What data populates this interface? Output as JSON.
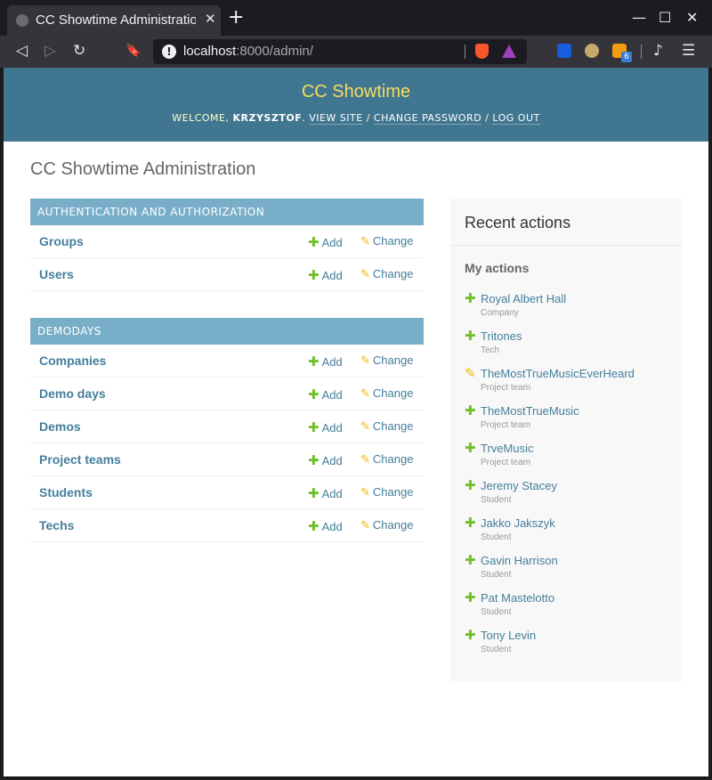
{
  "browser": {
    "tab_title": "CC Showtime Administration",
    "close_symbol": "✕",
    "newtab_symbol": "+",
    "url_host": "localhost",
    "url_rest": ":8000/admin/",
    "extension_badge": "6",
    "window_controls": {
      "minimize": "—",
      "maximize": "☐",
      "close": "✕"
    },
    "nav_glyphs": {
      "back": "◁",
      "forward": "▷",
      "reload": "↻",
      "bookmark": "🔖",
      "menu": "☰",
      "playlist": "♪"
    }
  },
  "header": {
    "site_name": "CC Showtime",
    "welcome": "WELCOME,",
    "username": "KRZYSZTOF",
    "links": [
      "VIEW SITE",
      "CHANGE PASSWORD",
      "LOG OUT"
    ],
    "sep": "/"
  },
  "page_title": "CC Showtime Administration",
  "labels": {
    "add": "Add",
    "change": "Change",
    "plus": "✚",
    "pencil": "✎"
  },
  "modules": [
    {
      "caption": "AUTHENTICATION AND AUTHORIZATION",
      "models": [
        "Groups",
        "Users"
      ]
    },
    {
      "caption": "DEMODAYS",
      "models": [
        "Companies",
        "Demo days",
        "Demos",
        "Project teams",
        "Students",
        "Techs"
      ]
    }
  ],
  "recent": {
    "title": "Recent actions",
    "subtitle": "My actions",
    "actions": [
      {
        "type": "add",
        "name": "Royal Albert Hall",
        "model": "Company"
      },
      {
        "type": "add",
        "name": "Tritones",
        "model": "Tech"
      },
      {
        "type": "change",
        "name": "TheMostTrueMusicEverHeard",
        "model": "Project team"
      },
      {
        "type": "add",
        "name": "TheMostTrueMusic",
        "model": "Project team"
      },
      {
        "type": "add",
        "name": "TrveMusic",
        "model": "Project team"
      },
      {
        "type": "add",
        "name": "Jeremy Stacey",
        "model": "Student"
      },
      {
        "type": "add",
        "name": "Jakko Jakszyk",
        "model": "Student"
      },
      {
        "type": "add",
        "name": "Gavin Harrison",
        "model": "Student"
      },
      {
        "type": "add",
        "name": "Pat Mastelotto",
        "model": "Student"
      },
      {
        "type": "add",
        "name": "Tony Levin",
        "model": "Student"
      }
    ]
  },
  "colors": {
    "header_bg": "#417690",
    "site_name": "#f5dd5d",
    "module_caption_bg": "#79aec8",
    "link": "#447e9b",
    "add_green": "#70bf2b",
    "change_yellow": "#efb80b"
  }
}
